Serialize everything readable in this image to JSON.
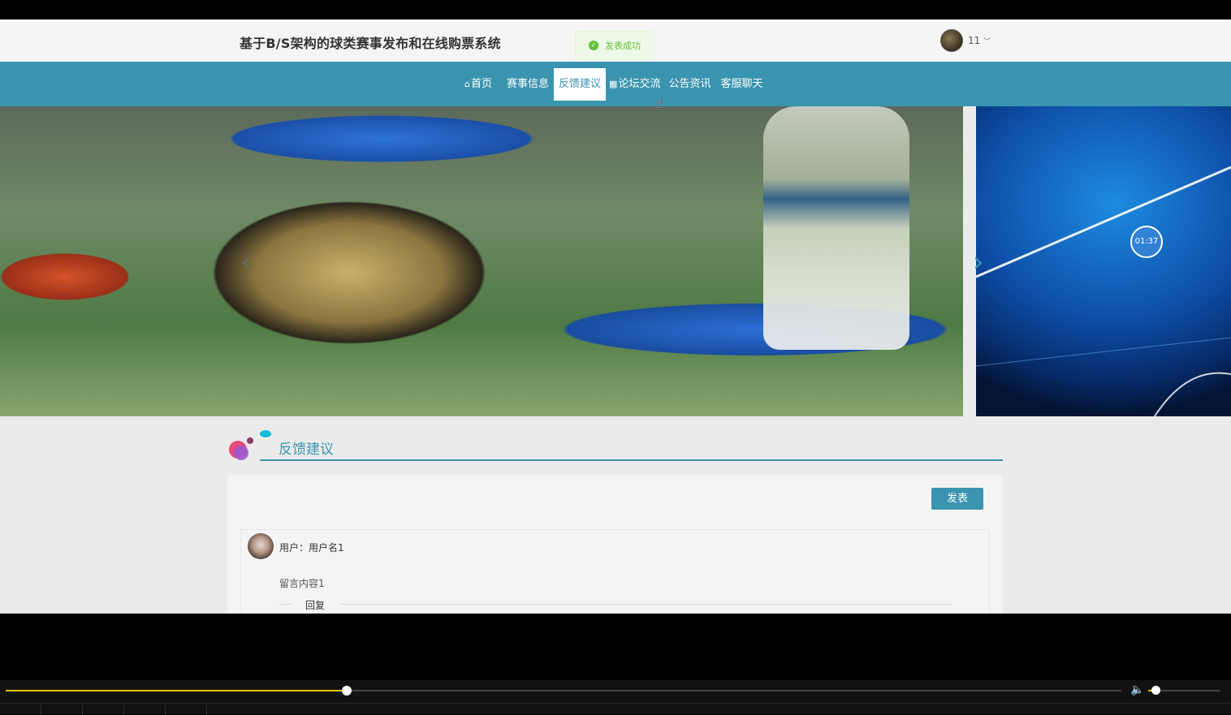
{
  "header": {
    "site_title": "基于B/S架构的球类赛事发布和在线购票系统",
    "toast": "发表成功",
    "user_name": "11"
  },
  "nav": {
    "items": [
      {
        "label": "首页",
        "icon": "home-icon"
      },
      {
        "label": "赛事信息"
      },
      {
        "label": "反馈建议",
        "active": true
      },
      {
        "label": "论坛交流",
        "icon": "grid-icon"
      },
      {
        "label": "公告资讯"
      },
      {
        "label": "客服聊天"
      }
    ]
  },
  "banner": {
    "timer": "01:37"
  },
  "section": {
    "title": "反馈建议",
    "post_button": "发表"
  },
  "messages": [
    {
      "user_label": "用户：用户名1",
      "content": "留言内容1",
      "reply_label": "回复"
    }
  ],
  "player": {
    "progress": 0.306,
    "volume": 0.1
  },
  "colors": {
    "accent": "#3a94af",
    "toast_green": "#67c23a",
    "progress_yellow": "#f5c400"
  }
}
